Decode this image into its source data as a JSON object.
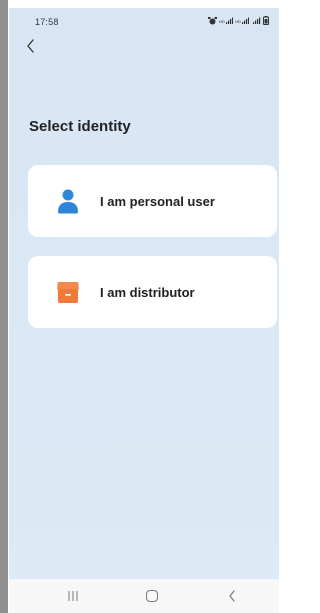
{
  "status_bar": {
    "time": "17:58",
    "icons": [
      "alarm-icon",
      "hd-signal-icon",
      "hd-signal-icon",
      "4g-signal-icon",
      "battery-icon"
    ]
  },
  "header": {
    "back_icon": "chevron-left-icon"
  },
  "page": {
    "title": "Select identity"
  },
  "options": [
    {
      "label": "I am personal user",
      "icon": "person-icon",
      "icon_color": "#2f86d6"
    },
    {
      "label": "I am distributor",
      "icon": "store-icon",
      "icon_color": "#f07a3a"
    }
  ],
  "nav_bar": {
    "buttons": [
      "recents-icon",
      "home-icon",
      "back-icon"
    ]
  },
  "colors": {
    "background": "#d9e7f5",
    "card": "#ffffff",
    "text": "#222222"
  }
}
